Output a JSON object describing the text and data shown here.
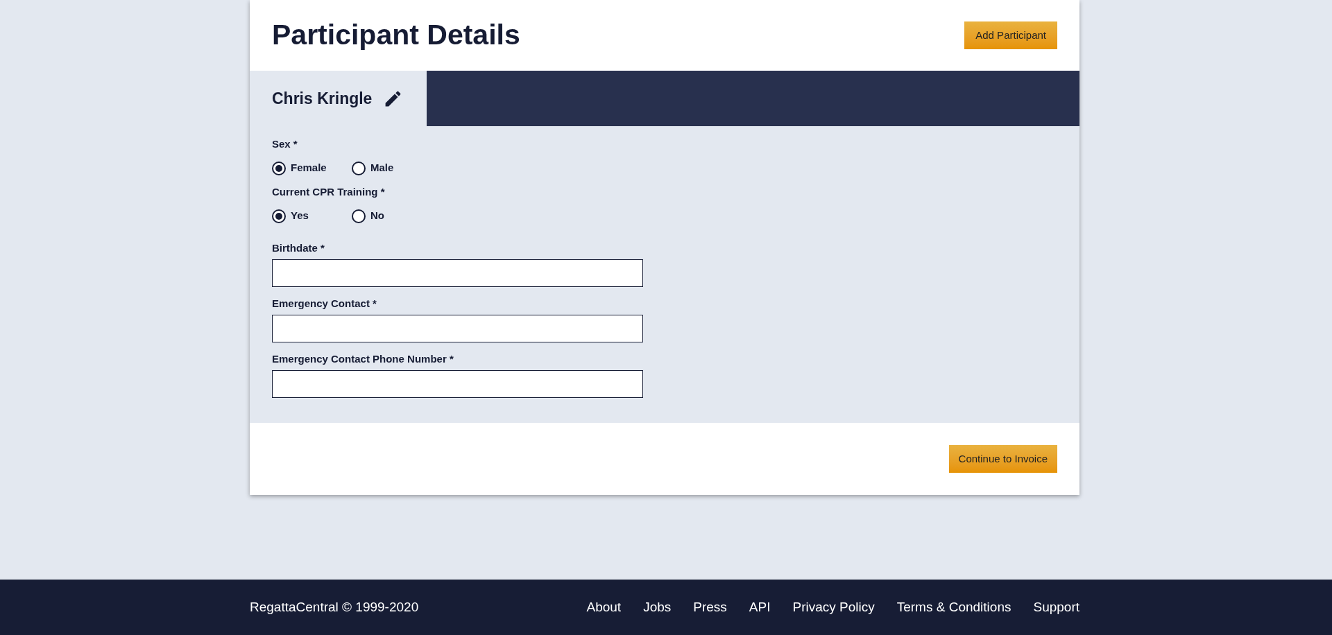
{
  "header": {
    "title": "Participant Details",
    "add_button": "Add Participant"
  },
  "participant_tabs": [
    {
      "name": "Chris Kringle",
      "selected": true
    }
  ],
  "form": {
    "radio_groups": [
      {
        "label": "Sex *",
        "options": [
          {
            "label": "Female",
            "selected": true
          },
          {
            "label": "Male",
            "selected": false
          }
        ]
      },
      {
        "label": "Current CPR Training *",
        "options": [
          {
            "label": "Yes",
            "selected": true
          },
          {
            "label": "No",
            "selected": false
          }
        ]
      }
    ],
    "fields": [
      {
        "label": "Birthdate *"
      },
      {
        "label": "Emergency Contact *"
      },
      {
        "label": "Emergency Contact Phone Number *"
      }
    ]
  },
  "continue_button": "Continue to Invoice",
  "footer": {
    "copyright": "RegattaCentral © 1999-2020",
    "links": [
      "About",
      "Jobs",
      "Press",
      "API",
      "Privacy Policy",
      "Terms & Conditions",
      "Support"
    ]
  }
}
